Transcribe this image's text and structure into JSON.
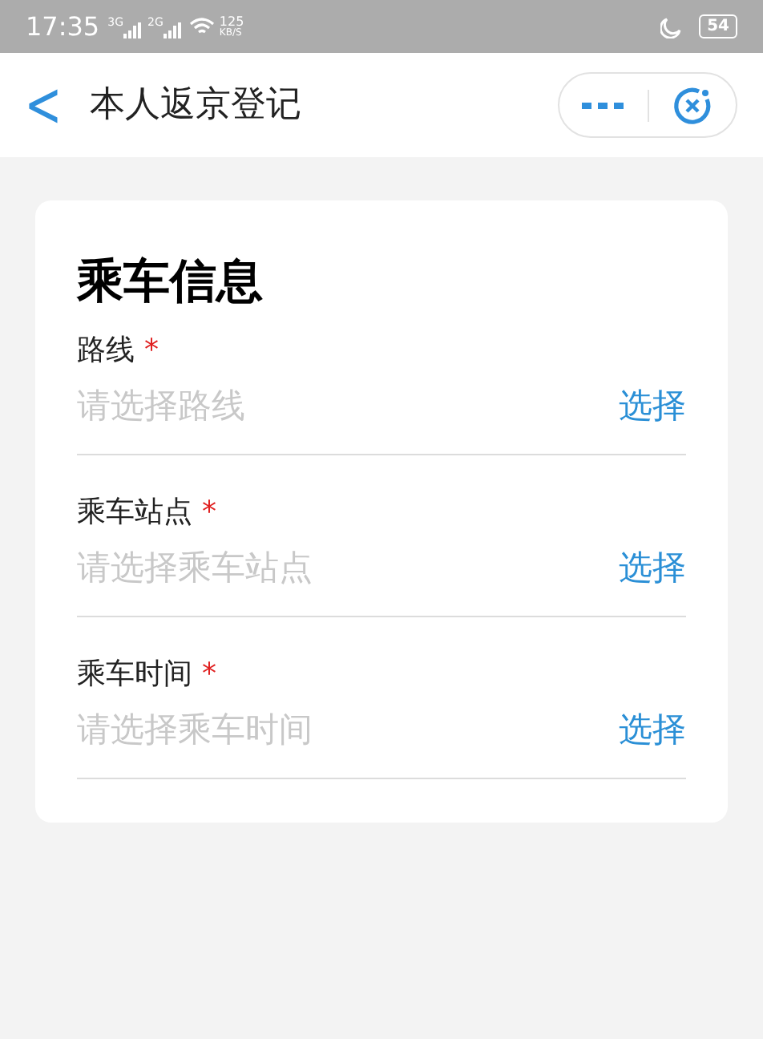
{
  "status_bar": {
    "time": "17:35",
    "network_1": "3G",
    "network_2": "2G",
    "speed_value": "125",
    "speed_unit": "KB/S",
    "battery": "54"
  },
  "header": {
    "back": "<",
    "title": "本人返京登记"
  },
  "card": {
    "title": "乘车信息",
    "fields": [
      {
        "label": "路线",
        "required_mark": "*",
        "placeholder": "请选择路线",
        "action": "选择"
      },
      {
        "label": "乘车站点",
        "required_mark": "*",
        "placeholder": "请选择乘车站点",
        "action": "选择"
      },
      {
        "label": "乘车时间",
        "required_mark": "*",
        "placeholder": "请选择乘车时间",
        "action": "选择"
      }
    ]
  }
}
